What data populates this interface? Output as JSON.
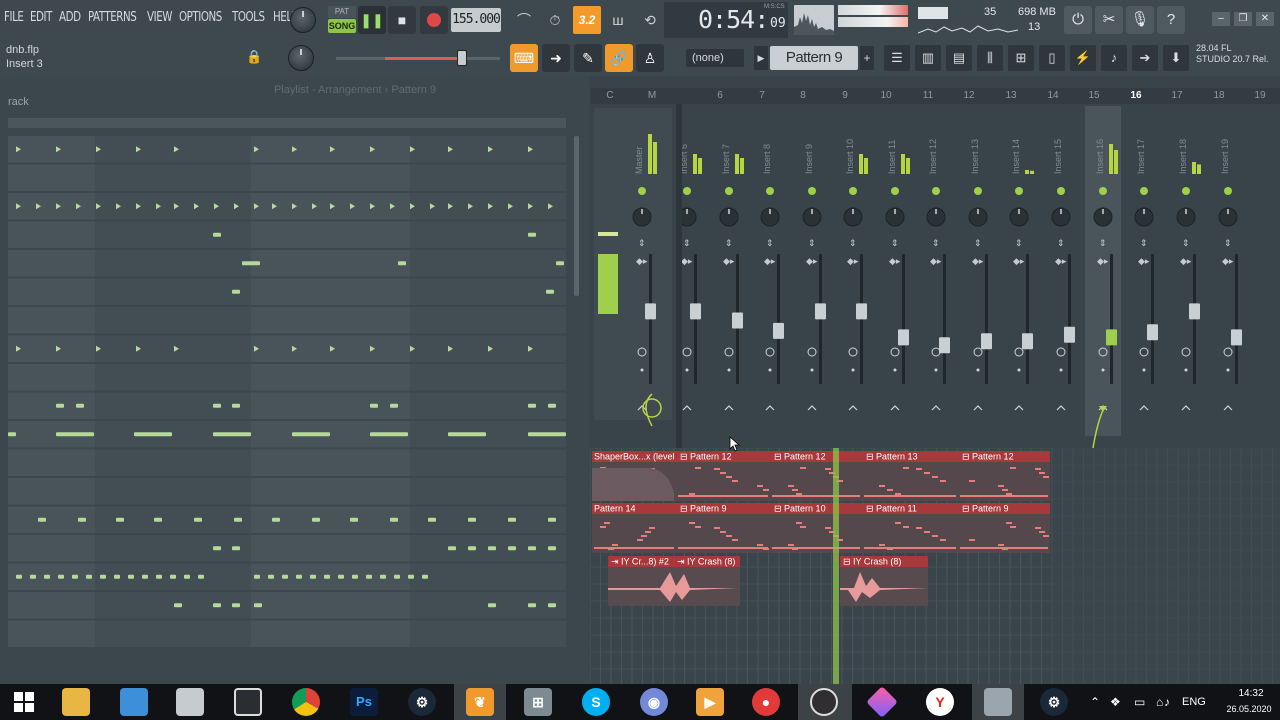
{
  "menu": [
    "FILE",
    "EDIT",
    "ADD",
    "PATTERNS",
    "VIEW",
    "OPTIONS",
    "TOOLS",
    "HELP"
  ],
  "transport": {
    "pat_label": "PAT",
    "song_label": "SONG",
    "tempo": "155.000",
    "snap": "3.2",
    "time": "0:54:",
    "time_small": "09",
    "time_unit": "M:S:CS"
  },
  "monitor": {
    "cpu": "35",
    "memory": "698 MB",
    "polyphony": "13"
  },
  "project": {
    "file": "dnb.flp",
    "insert": "Insert 3"
  },
  "pattern": {
    "none_label": "(none)",
    "current": "Pattern 9",
    "news_time": "28.04",
    "news_line1": "FL",
    "news_line2": "STUDIO 20.7 Rel."
  },
  "rack": {
    "title": "rack",
    "ghost_title": "Playlist - Arrangement › Pattern 9"
  },
  "mixer": {
    "header_numbers": [
      "C",
      "M",
      "6",
      "7",
      "8",
      "9",
      "10",
      "11",
      "12",
      "13",
      "14",
      "15",
      "16",
      "17",
      "18",
      "19"
    ],
    "selected_number": "16",
    "track_names": [
      "Master",
      "Insert 6",
      "Insert 7",
      "Insert 8",
      "Insert 9",
      "Insert 10",
      "Insert 11",
      "Insert 12",
      "Insert 13",
      "Insert 14",
      "Insert 15",
      "Insert 16",
      "Insert 17",
      "Insert 18",
      "Insert 19"
    ],
    "fader_levels": [
      0.62,
      0.62,
      0.55,
      0.47,
      0.62,
      0.62,
      0.42,
      0.36,
      0.39,
      0.39,
      0.44,
      0.42,
      0.46,
      0.62,
      0.42
    ]
  },
  "playlist": {
    "clips_row1": [
      "ShaperBox...x (level",
      "Pattern 12",
      "Pattern 12",
      "Pattern 13",
      "Pattern 12"
    ],
    "clips_row2": [
      "Pattern 14",
      "Pattern 9",
      "Pattern 10",
      "Pattern 11",
      "Pattern 9"
    ],
    "clips_row3": [
      "IY Cr...8) #2",
      "IY Crash (8)",
      "IY Crash (8)"
    ]
  },
  "taskbar": {
    "lang": "ENG",
    "time": "14:32",
    "date": "26.05.2020",
    "ps_label": "Ps"
  },
  "colors": {
    "accent_orange": "#f19a2c",
    "song_green": "#8fc44b",
    "meter_green": "#9ed04e",
    "clip_red": "#a7383b",
    "clip_body": "#55484d",
    "playhead": "#8fc44b"
  }
}
